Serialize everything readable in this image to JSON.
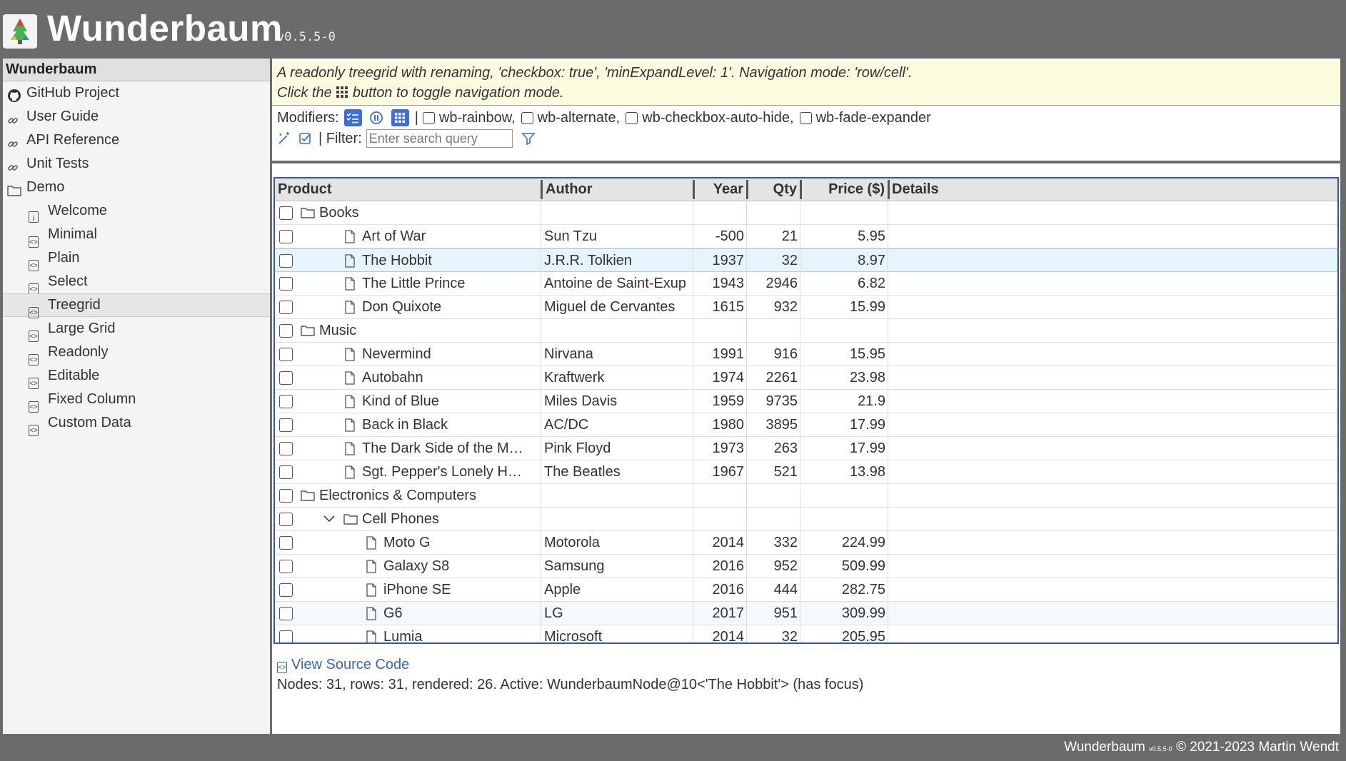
{
  "header": {
    "title": "Wunderbaum",
    "version": "v0.5.5-0"
  },
  "sidebar": {
    "title": "Wunderbaum",
    "items": [
      {
        "label": "GitHub Project",
        "icon": "github-icon",
        "level": 0
      },
      {
        "label": "User Guide",
        "icon": "link-icon",
        "level": 0
      },
      {
        "label": "API Reference",
        "icon": "link-icon",
        "level": 0
      },
      {
        "label": "Unit Tests",
        "icon": "link-icon",
        "level": 0
      },
      {
        "label": "Demo",
        "icon": "folder-icon",
        "level": 0
      },
      {
        "label": "Welcome",
        "icon": "info-icon",
        "level": 1
      },
      {
        "label": "Minimal",
        "icon": "code-icon",
        "level": 1
      },
      {
        "label": "Plain",
        "icon": "code-icon",
        "level": 1
      },
      {
        "label": "Select",
        "icon": "code-icon",
        "level": 1
      },
      {
        "label": "Treegrid",
        "icon": "code-icon",
        "level": 1,
        "active": true
      },
      {
        "label": "Large Grid",
        "icon": "code-icon",
        "level": 1
      },
      {
        "label": "Readonly",
        "icon": "code-icon",
        "level": 1
      },
      {
        "label": "Editable",
        "icon": "code-icon",
        "level": 1
      },
      {
        "label": "Fixed Column",
        "icon": "code-icon",
        "level": 1
      },
      {
        "label": "Custom Data",
        "icon": "code-icon",
        "level": 1
      }
    ]
  },
  "main": {
    "description_line1": "A readonly treegrid with renaming, 'checkbox: true', 'minExpandLevel: 1'. Navigation mode: 'row/cell'.",
    "description_line2_pre": "Click the",
    "description_line2_post": "button to toggle navigation mode.",
    "modifiers_label": "Modifiers:",
    "modifier_options": [
      "wb-rainbow,",
      "wb-alternate,",
      "wb-checkbox-auto-hide,",
      "wb-fade-expander"
    ],
    "filter_label": "| Filter:",
    "filter_placeholder": "Enter search query",
    "view_source": "View Source Code",
    "status": "Nodes: 31, rows: 31, rendered: 26. Active: WunderbaumNode@10<'The Hobbit'> (has focus)"
  },
  "grid": {
    "columns": [
      "Product",
      "Author",
      "Year",
      "Qty",
      "Price ($)",
      "Details"
    ],
    "rows": [
      {
        "level": 0,
        "folder": true,
        "title": "Books",
        "author": "",
        "year": "",
        "qty": "",
        "price": ""
      },
      {
        "level": 1,
        "folder": false,
        "title": "Art of War",
        "author": "Sun Tzu",
        "year": "-500",
        "qty": "21",
        "price": "5.95"
      },
      {
        "level": 1,
        "folder": false,
        "title": "The Hobbit",
        "author": "J.R.R. Tolkien",
        "year": "1937",
        "qty": "32",
        "price": "8.97",
        "active": true
      },
      {
        "level": 1,
        "folder": false,
        "title": "The Little Prince",
        "author": "Antoine de Saint-Exup",
        "year": "1943",
        "qty": "2946",
        "price": "6.82"
      },
      {
        "level": 1,
        "folder": false,
        "title": "Don Quixote",
        "author": "Miguel de Cervantes",
        "year": "1615",
        "qty": "932",
        "price": "15.99"
      },
      {
        "level": 0,
        "folder": true,
        "title": "Music",
        "author": "",
        "year": "",
        "qty": "",
        "price": ""
      },
      {
        "level": 1,
        "folder": false,
        "title": "Nevermind",
        "author": "Nirvana",
        "year": "1991",
        "qty": "916",
        "price": "15.95"
      },
      {
        "level": 1,
        "folder": false,
        "title": "Autobahn",
        "author": "Kraftwerk",
        "year": "1974",
        "qty": "2261",
        "price": "23.98"
      },
      {
        "level": 1,
        "folder": false,
        "title": "Kind of Blue",
        "author": "Miles Davis",
        "year": "1959",
        "qty": "9735",
        "price": "21.9"
      },
      {
        "level": 1,
        "folder": false,
        "title": "Back in Black",
        "author": "AC/DC",
        "year": "1980",
        "qty": "3895",
        "price": "17.99"
      },
      {
        "level": 1,
        "folder": false,
        "title": "The Dark Side of the M…",
        "author": "Pink Floyd",
        "year": "1973",
        "qty": "263",
        "price": "17.99"
      },
      {
        "level": 1,
        "folder": false,
        "title": "Sgt. Pepper's Lonely H…",
        "author": "The Beatles",
        "year": "1967",
        "qty": "521",
        "price": "13.98"
      },
      {
        "level": 0,
        "folder": true,
        "title": "Electronics & Computers",
        "author": "",
        "year": "",
        "qty": "",
        "price": ""
      },
      {
        "level": 1,
        "folder": true,
        "title": "Cell Phones",
        "author": "",
        "year": "",
        "qty": "",
        "price": "",
        "expanded": true
      },
      {
        "level": 2,
        "folder": false,
        "title": "Moto G",
        "author": "Motorola",
        "year": "2014",
        "qty": "332",
        "price": "224.99"
      },
      {
        "level": 2,
        "folder": false,
        "title": "Galaxy S8",
        "author": "Samsung",
        "year": "2016",
        "qty": "952",
        "price": "509.99"
      },
      {
        "level": 2,
        "folder": false,
        "title": "iPhone SE",
        "author": "Apple",
        "year": "2016",
        "qty": "444",
        "price": "282.75"
      },
      {
        "level": 2,
        "folder": false,
        "title": "G6",
        "author": "LG",
        "year": "2017",
        "qty": "951",
        "price": "309.99",
        "hover": true
      },
      {
        "level": 2,
        "folder": false,
        "title": "Lumia",
        "author": "Microsoft",
        "year": "2014",
        "qty": "32",
        "price": "205.95"
      }
    ]
  },
  "footer": {
    "text_pre": "Wunderbaum",
    "version_small": "v0.5.5-0",
    "text_post": "© 2021-2023 Martin Wendt"
  },
  "colors": {
    "accent": "#3b6ed8",
    "grid_border": "#2f55b5",
    "active_row": "#e6f4fb",
    "link": "#3a62c4",
    "description_bg": "#fbfbe0"
  }
}
